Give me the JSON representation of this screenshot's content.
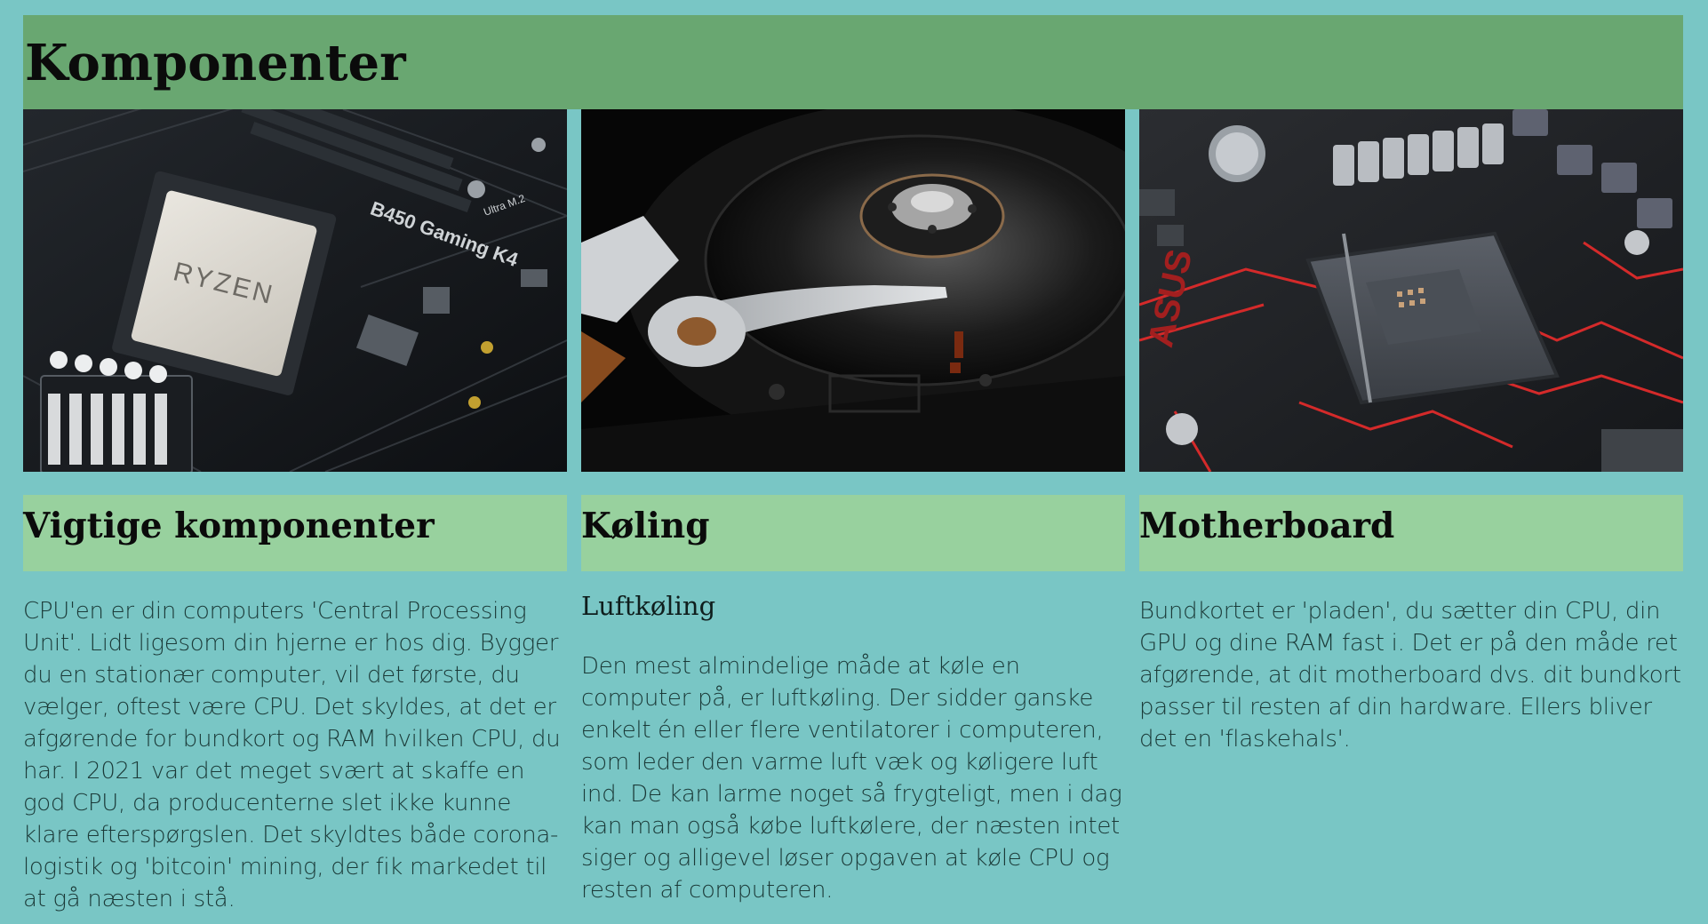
{
  "page": {
    "title": "Komponenter"
  },
  "cards": [
    {
      "title": "Vigtige komponenter",
      "subtitle": "",
      "text": "CPU'en er din computers 'Central Processing Unit'. Lidt ligesom din hjerne er hos dig. Bygger du en stationær computer, vil det første, du vælger, oftest være CPU. Det skyldes, at det er afgørende for bundkort og RAM hvilken CPU, du har. I 2021 var det meget svært at skaffe en god CPU, da producenterne slet ikke kunne klare efterspørgslen. Det skyldtes både corona-logistik og 'bitcoin' mining, der fik markedet til at gå næsten i stå.",
      "image_labels": [
        "RYZEN",
        "B450 Gaming K4",
        "Ultra M.2"
      ]
    },
    {
      "title": "Køling",
      "subtitle": "Luftkøling",
      "text": "Den mest almindelige måde at køle en computer på, er luftkøling. Der sidder ganske enkelt én eller flere ventilatorer i computeren, som leder den varme luft væk og køligere luft ind. De kan larme noget så frygteligt, men i dag kan man også købe luftkølere, der næsten intet siger og alligevel løser opgaven at køle CPU og resten af computeren.",
      "image_labels": []
    },
    {
      "title": "Motherboard",
      "subtitle": "",
      "text": "Bundkortet er 'pladen', du sætter din CPU, din GPU og dine RAM fast i. Det er på den måde ret afgørende, at dit motherboard dvs. dit bundkort passer til resten af din hardware. Ellers bliver det en 'flaskehals'.",
      "image_labels": [
        "ASUS"
      ]
    }
  ],
  "colors": {
    "background": "#79c6c5",
    "header": "#69a771",
    "card_header": "#98d19e",
    "heading_text": "#0b0b0b",
    "body_text": "#1b3a38"
  }
}
